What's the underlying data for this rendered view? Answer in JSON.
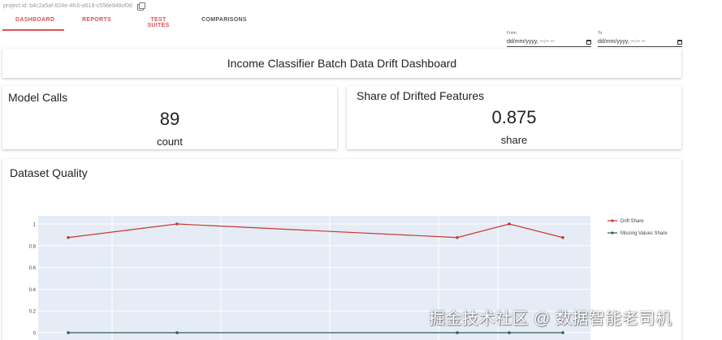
{
  "project": {
    "id_text": "project id: b4c2a5af-824e-4fc0-a518-c556e948cf0d"
  },
  "tabs": [
    {
      "label": "DASHBOARD",
      "active": true
    },
    {
      "label": "REPORTS",
      "active": false
    },
    {
      "label": "TEST SUITES",
      "active": false
    },
    {
      "label": "COMPARISONS",
      "active": false
    }
  ],
  "filters": {
    "from_label": "From",
    "to_label": "To",
    "from_value": "dd/mm/yyyy, --:-- --",
    "to_value": "dd/mm/yyyy, --:-- --"
  },
  "dashboard": {
    "title": "Income Classifier Batch Data Drift Dashboard"
  },
  "kpis": [
    {
      "title": "Model Calls",
      "value": "89",
      "unit": "count"
    },
    {
      "title": "Share of Drifted Features",
      "value": "0.875",
      "unit": "share"
    }
  ],
  "quality": {
    "title": "Dataset Quality"
  },
  "watermark": "掘金技术社区 @ 数据智能老司机",
  "colors": {
    "accent": "#d9534f",
    "drift_line": "#c73a30",
    "missing_line": "#2f5e5a",
    "plot_bg": "#e5ecf6"
  },
  "chart_data": {
    "type": "line",
    "x": [
      1,
      2,
      3,
      4,
      5
    ],
    "series": [
      {
        "name": "Drift Share",
        "values": [
          0.875,
          1.0,
          0.875,
          1.0,
          0.875
        ]
      },
      {
        "name": "Missing Values Share",
        "values": [
          0,
          0,
          0,
          0,
          0
        ]
      }
    ],
    "yticks": [
      "1",
      "0.8",
      "0.6",
      "0.4",
      "0.2",
      "0"
    ],
    "ylim": [
      0,
      1.05
    ],
    "grid": true,
    "legend": "right"
  }
}
